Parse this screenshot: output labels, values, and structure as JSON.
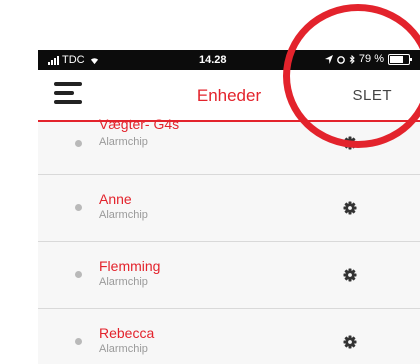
{
  "status_bar": {
    "carrier": "TDC",
    "time": "14.28",
    "battery": "79 %",
    "battery_level": 0.79
  },
  "navbar": {
    "title": "Enheder",
    "action_label": "SLET"
  },
  "devices": [
    {
      "name": "Vægter- G4s",
      "type": "Alarmchip"
    },
    {
      "name": "Anne",
      "type": "Alarmchip"
    },
    {
      "name": "Flemming",
      "type": "Alarmchip"
    },
    {
      "name": "Rebecca",
      "type": "Alarmchip"
    }
  ],
  "colors": {
    "accent": "#e3232c",
    "annotation_circle": "#e3232c"
  },
  "icons": {
    "menu": "hamburger-icon",
    "settings": "gear-icon"
  }
}
